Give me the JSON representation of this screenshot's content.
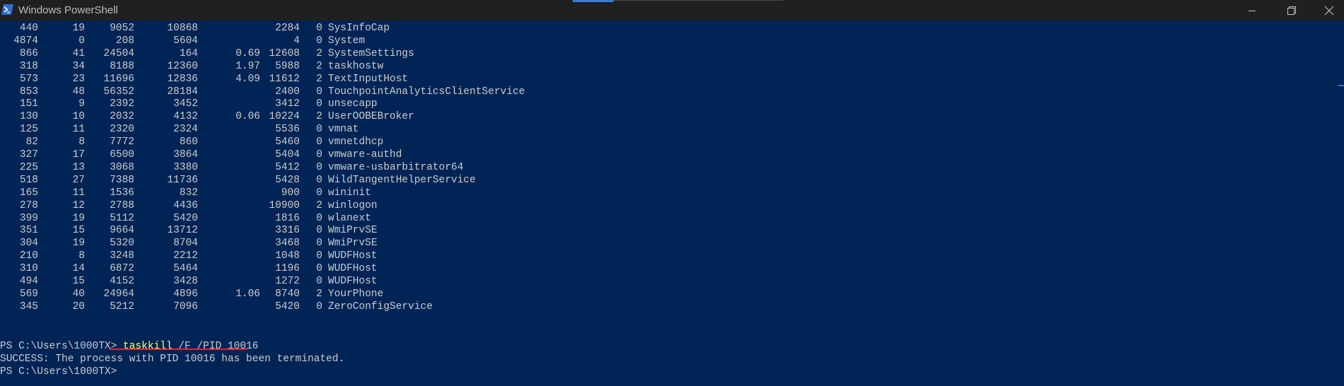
{
  "window": {
    "title": "Windows PowerShell",
    "icon": "powershell-icon",
    "controls": [
      "minimize-icon",
      "maximize-icon",
      "close-icon"
    ],
    "colors": {
      "console_bg": "#012456",
      "text": "#cccccc",
      "command": "#ffff66",
      "titlebar": "#202020",
      "underline": "#e0262d"
    }
  },
  "processes": [
    {
      "handles": "440",
      "npm": "19",
      "pm": "9052",
      "ws": "10868",
      "cpu": "",
      "id": "2284",
      "si": "0",
      "name": "SysInfoCap"
    },
    {
      "handles": "4874",
      "npm": "0",
      "pm": "208",
      "ws": "5604",
      "cpu": "",
      "id": "4",
      "si": "0",
      "name": "System"
    },
    {
      "handles": "866",
      "npm": "41",
      "pm": "24504",
      "ws": "164",
      "cpu": "0.69",
      "id": "12608",
      "si": "2",
      "name": "SystemSettings"
    },
    {
      "handles": "318",
      "npm": "34",
      "pm": "8188",
      "ws": "12360",
      "cpu": "1.97",
      "id": "5988",
      "si": "2",
      "name": "taskhostw"
    },
    {
      "handles": "573",
      "npm": "23",
      "pm": "11696",
      "ws": "12836",
      "cpu": "4.09",
      "id": "11612",
      "si": "2",
      "name": "TextInputHost"
    },
    {
      "handles": "853",
      "npm": "48",
      "pm": "56352",
      "ws": "28184",
      "cpu": "",
      "id": "2400",
      "si": "0",
      "name": "TouchpointAnalyticsClientService"
    },
    {
      "handles": "151",
      "npm": "9",
      "pm": "2392",
      "ws": "3452",
      "cpu": "",
      "id": "3412",
      "si": "0",
      "name": "unsecapp"
    },
    {
      "handles": "130",
      "npm": "10",
      "pm": "2032",
      "ws": "4132",
      "cpu": "0.06",
      "id": "10224",
      "si": "2",
      "name": "UserOOBEBroker"
    },
    {
      "handles": "125",
      "npm": "11",
      "pm": "2320",
      "ws": "2324",
      "cpu": "",
      "id": "5536",
      "si": "0",
      "name": "vmnat"
    },
    {
      "handles": "82",
      "npm": "8",
      "pm": "7772",
      "ws": "860",
      "cpu": "",
      "id": "5460",
      "si": "0",
      "name": "vmnetdhcp"
    },
    {
      "handles": "327",
      "npm": "17",
      "pm": "6500",
      "ws": "3864",
      "cpu": "",
      "id": "5404",
      "si": "0",
      "name": "vmware-authd"
    },
    {
      "handles": "225",
      "npm": "13",
      "pm": "3068",
      "ws": "3380",
      "cpu": "",
      "id": "5412",
      "si": "0",
      "name": "vmware-usbarbitrator64"
    },
    {
      "handles": "518",
      "npm": "27",
      "pm": "7388",
      "ws": "11736",
      "cpu": "",
      "id": "5428",
      "si": "0",
      "name": "WildTangentHelperService"
    },
    {
      "handles": "165",
      "npm": "11",
      "pm": "1536",
      "ws": "832",
      "cpu": "",
      "id": "900",
      "si": "0",
      "name": "wininit"
    },
    {
      "handles": "278",
      "npm": "12",
      "pm": "2788",
      "ws": "4436",
      "cpu": "",
      "id": "10900",
      "si": "2",
      "name": "winlogon"
    },
    {
      "handles": "399",
      "npm": "19",
      "pm": "5112",
      "ws": "5420",
      "cpu": "",
      "id": "1816",
      "si": "0",
      "name": "wlanext"
    },
    {
      "handles": "351",
      "npm": "15",
      "pm": "9664",
      "ws": "13712",
      "cpu": "",
      "id": "3316",
      "si": "0",
      "name": "WmiPrvSE"
    },
    {
      "handles": "304",
      "npm": "19",
      "pm": "5320",
      "ws": "8704",
      "cpu": "",
      "id": "3468",
      "si": "0",
      "name": "WmiPrvSE"
    },
    {
      "handles": "210",
      "npm": "8",
      "pm": "3248",
      "ws": "2212",
      "cpu": "",
      "id": "1048",
      "si": "0",
      "name": "WUDFHost"
    },
    {
      "handles": "310",
      "npm": "14",
      "pm": "6872",
      "ws": "5464",
      "cpu": "",
      "id": "1196",
      "si": "0",
      "name": "WUDFHost"
    },
    {
      "handles": "494",
      "npm": "15",
      "pm": "4152",
      "ws": "3428",
      "cpu": "",
      "id": "1272",
      "si": "0",
      "name": "WUDFHost"
    },
    {
      "handles": "569",
      "npm": "40",
      "pm": "24964",
      "ws": "4896",
      "cpu": "1.06",
      "id": "8740",
      "si": "2",
      "name": "YourPhone"
    },
    {
      "handles": "345",
      "npm": "20",
      "pm": "5212",
      "ws": "7096",
      "cpu": "",
      "id": "5420",
      "si": "0",
      "name": "ZeroConfigService"
    }
  ],
  "session": {
    "prompt": "PS C:\\Users\\1000TX> ",
    "command": "taskkill",
    "args": " /F /PID 10016",
    "output": "SUCCESS: The process with PID 10016 has been terminated.",
    "final_prompt": "PS C:\\Users\\1000TX>"
  }
}
